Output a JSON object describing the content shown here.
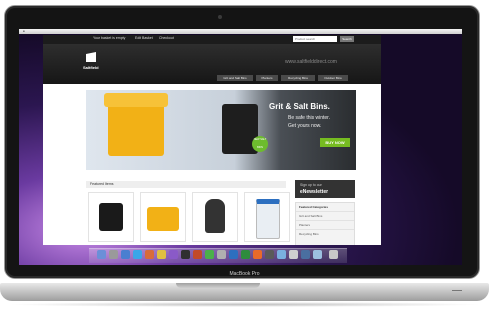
{
  "device": {
    "brand_label": "MacBook Pro"
  },
  "browser": {
    "top_links": [
      "Your basket is empty",
      "Edit Basket",
      "Checkout"
    ],
    "search_placeholder": "Product search",
    "search_button": "Search"
  },
  "site": {
    "logo_text": "Saltfield",
    "url_text": "www.saltfielddirect.com",
    "nav": [
      "Grit and Salt Bins",
      "Planters",
      "Recycling Bins",
      "Outdoor Bins"
    ]
  },
  "hero": {
    "title": "Grit & Salt Bins.",
    "line1": "Be safe this winter.",
    "line2": "Get yours now.",
    "cta": "BUY NOW",
    "badge": "NEW SALT BINS"
  },
  "featured": {
    "title": "Featured Items"
  },
  "sidebar": {
    "newsletter_small": "Sign up to our",
    "newsletter_big": "eNewsletter",
    "categories_title": "Featured Categories",
    "categories": [
      "Grit and Salt Bins",
      "Planters",
      "Recycling Bins"
    ]
  },
  "colors": {
    "accent_green": "#76bc21",
    "header_dark": "#1c1c1c",
    "bin_yellow": "#f2b116"
  }
}
